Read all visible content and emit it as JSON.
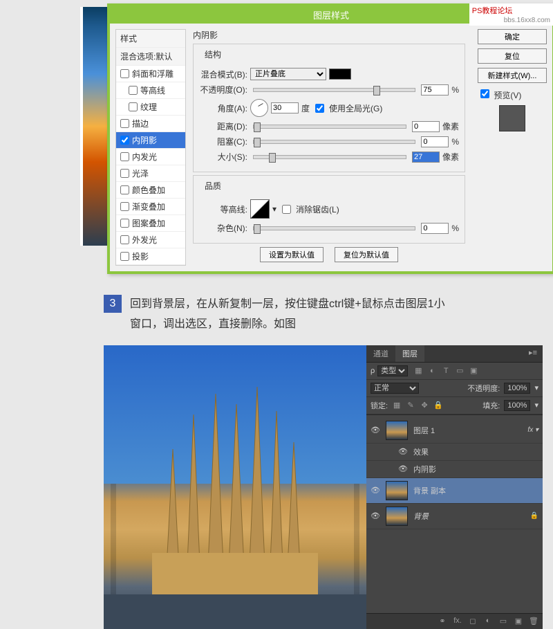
{
  "watermark": {
    "line1": "PS教程论坛",
    "line2": "bbs.16xx8.com"
  },
  "dialog": {
    "title": "图层样式",
    "left": {
      "hdr1": "样式",
      "hdr2": "混合选项:默认",
      "items": [
        {
          "label": "斜面和浮雕",
          "checked": false
        },
        {
          "label": "等高线",
          "checked": false
        },
        {
          "label": "纹理",
          "checked": false
        },
        {
          "label": "描边",
          "checked": false
        },
        {
          "label": "内阴影",
          "checked": true,
          "sel": true
        },
        {
          "label": "内发光",
          "checked": false
        },
        {
          "label": "光泽",
          "checked": false
        },
        {
          "label": "颜色叠加",
          "checked": false
        },
        {
          "label": "渐变叠加",
          "checked": false
        },
        {
          "label": "图案叠加",
          "checked": false
        },
        {
          "label": "外发光",
          "checked": false
        },
        {
          "label": "投影",
          "checked": false
        }
      ]
    },
    "center": {
      "section_title": "内阴影",
      "structure": "结构",
      "blend_mode_label": "混合模式(B):",
      "blend_mode_value": "正片叠底",
      "opacity_label": "不透明度(O):",
      "opacity_value": "75",
      "pct": "%",
      "angle_label": "角度(A):",
      "angle_value": "30",
      "deg": "度",
      "use_global": "使用全局光(G)",
      "distance_label": "距离(D):",
      "distance_value": "0",
      "px": "像素",
      "choke_label": "阻塞(C):",
      "choke_value": "0",
      "size_label": "大小(S):",
      "size_value": "27",
      "quality": "品质",
      "contour_label": "等高线:",
      "antialias": "消除锯齿(L)",
      "noise_label": "杂色(N):",
      "noise_value": "0",
      "reset_default": "设置为默认值",
      "restore_default": "复位为默认值"
    },
    "right": {
      "ok": "确定",
      "cancel": "复位",
      "new_style": "新建样式(W)...",
      "preview": "预览(V)"
    }
  },
  "step": {
    "num": "3",
    "text": "回到背景层，在从新复制一层，按住键盘ctrl键+鼠标点击图层1小窗口，调出选区，直接删除。如图"
  },
  "panel": {
    "tab1": "通道",
    "tab2": "图层",
    "kind_label": "类型",
    "blend_mode": "正常",
    "opacity_label": "不透明度:",
    "opacity_value": "100%",
    "lock_label": "锁定:",
    "fill_label": "填充:",
    "fill_value": "100%",
    "layers": [
      {
        "name": "图层 1",
        "thumb": "img",
        "fx": true
      },
      {
        "name": "效果",
        "sub": true
      },
      {
        "name": "内阴影",
        "sub": true
      },
      {
        "name": "背景 副本",
        "thumb": "img",
        "sel": true
      },
      {
        "name": "背景",
        "thumb": "bg",
        "lock": true,
        "italic": true
      }
    ]
  }
}
